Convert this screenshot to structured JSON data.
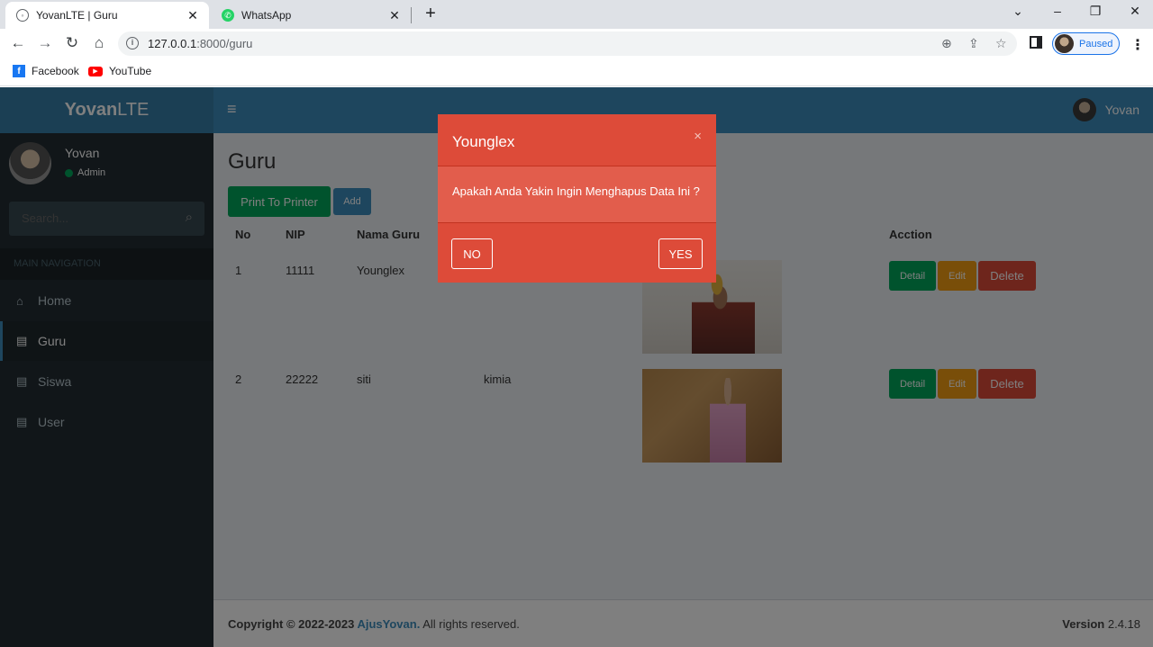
{
  "browser": {
    "tabs": [
      {
        "title": "YovanLTE | Guru",
        "close": "✕"
      },
      {
        "title": "WhatsApp",
        "close": "✕"
      }
    ],
    "new_tab": "+",
    "url_host": "127.0.0.1",
    "url_rest": ":8000/guru",
    "profile_status": "Paused",
    "bookmarks": [
      {
        "label": "Facebook",
        "icon": "facebook-icon"
      },
      {
        "label": "YouTube",
        "icon": "youtube-icon"
      }
    ]
  },
  "app": {
    "logo_bold": "Yovan",
    "logo_rest": "LTE",
    "top_user": "Yovan",
    "sidebar": {
      "user_name": "Yovan",
      "user_role": "Admin",
      "search_placeholder": "Search...",
      "nav_header": "MAIN NAVIGATION",
      "items": [
        {
          "label": "Home",
          "icon": "home-icon"
        },
        {
          "label": "Guru",
          "icon": "book-icon"
        },
        {
          "label": "Siswa",
          "icon": "book-icon"
        },
        {
          "label": "User",
          "icon": "book-icon"
        }
      ]
    },
    "page_title": "Guru",
    "buttons": {
      "print": "Print To Printer",
      "add": "Add"
    },
    "table": {
      "headers": [
        "No",
        "NIP",
        "Nama Guru",
        "Acction"
      ],
      "rows": [
        {
          "no": "1",
          "nip": "11111",
          "nama": "Younglex",
          "mapel": ""
        },
        {
          "no": "2",
          "nip": "22222",
          "nama": "siti",
          "mapel": "kimia"
        }
      ],
      "actions": {
        "detail": "Detail",
        "edit": "Edit",
        "delete": "Delete"
      }
    },
    "footer": {
      "copyright": "Copyright © 2022-2023 ",
      "brand": "AjusYovan.",
      "rights": " All rights reserved.",
      "version_label": "Version",
      "version": " 2.4.18"
    }
  },
  "modal": {
    "title": "Younglex",
    "close": "×",
    "message": "Apakah Anda Yakin Ingin Menghapus Data Ini ?",
    "no_label": "NO",
    "yes_label": "YES"
  },
  "colors": {
    "header": "#3c8dbc",
    "logo_bg": "#367fa9",
    "sidebar": "#222d32",
    "success": "#00a65a",
    "warning": "#f39c12",
    "danger": "#dd4b39"
  }
}
